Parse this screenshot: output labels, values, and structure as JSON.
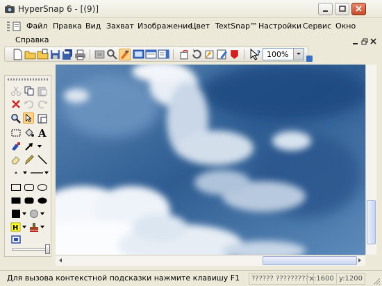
{
  "window": {
    "title": "HyperSnap 6 - [(9)]",
    "minimize_icon": "minimize-icon",
    "maximize_icon": "maximize-icon",
    "close_icon": "close-icon"
  },
  "menu": {
    "items": [
      "Файл",
      "Правка",
      "Вид",
      "Захват",
      "Изображение",
      "Цвет",
      "TextSnap™",
      "Настройки",
      "Сервис",
      "Окно",
      "Справка"
    ]
  },
  "toolbar": {
    "zoom_value": "100%"
  },
  "status": {
    "hint": "Для вызова контекстной подсказки нажмите клавишу F1",
    "cell1": "?????? ?????????:",
    "x": "x:1600",
    "y": "y:1200"
  },
  "colors": {
    "accent": "#ffd38a",
    "sky": "#355f8e"
  }
}
